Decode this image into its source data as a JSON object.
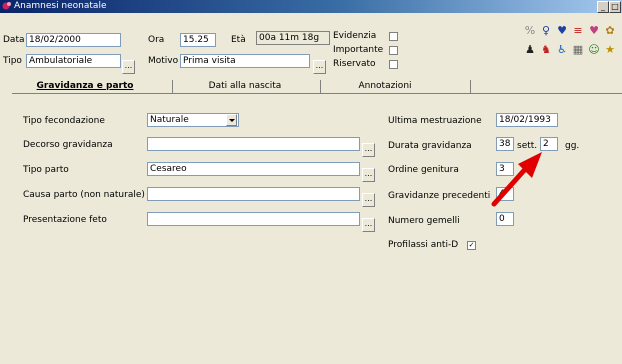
{
  "window": {
    "title": "Anamnesi neonatale"
  },
  "header": {
    "data_label": "Data",
    "data_value": "18/02/2000",
    "ora_label": "Ora",
    "ora_value": "15.25",
    "eta_label": "Età",
    "eta_value": "00a 11m 18g",
    "tipo_label": "Tipo",
    "tipo_value": "Ambulatoriale",
    "motivo_label": "Motivo",
    "motivo_value": "Prima visita",
    "evidenzia_label": "Evidenzia",
    "importante_label": "Importante",
    "riservato_label": "Riservato",
    "dots": "..."
  },
  "tabs": [
    {
      "label": "Gravidanza e parto"
    },
    {
      "label": "Dati alla nascita"
    },
    {
      "label": "Annotazioni"
    }
  ],
  "form": {
    "tipo_fecondazione_label": "Tipo fecondazione",
    "tipo_fecondazione_value": "Naturale",
    "decorso_label": "Decorso gravidanza",
    "decorso_value": "",
    "tipo_parto_label": "Tipo parto",
    "tipo_parto_value": "Cesareo",
    "causa_label": "Causa parto (non naturale)",
    "causa_value": "",
    "presentazione_label": "Presentazione feto",
    "presentazione_value": "",
    "ultima_label": "Ultima mestruazione",
    "ultima_value": "18/02/1993",
    "durata_label": "Durata gravidanza",
    "durata_sett_value": "38",
    "sett_label": "sett.",
    "durata_gg_value": "2",
    "gg_label": "gg.",
    "ordine_label": "Ordine genitura",
    "ordine_value": "3",
    "precedenti_label": "Gravidanze precedenti",
    "precedenti_value": "4",
    "gemelli_label": "Numero gemelli",
    "gemelli_value": "0",
    "profilassi_label": "Profilassi anti-D",
    "profilassi_checked": "✓"
  },
  "colors": {
    "arrow": "#e00000",
    "titlebar": "#0a246a"
  }
}
